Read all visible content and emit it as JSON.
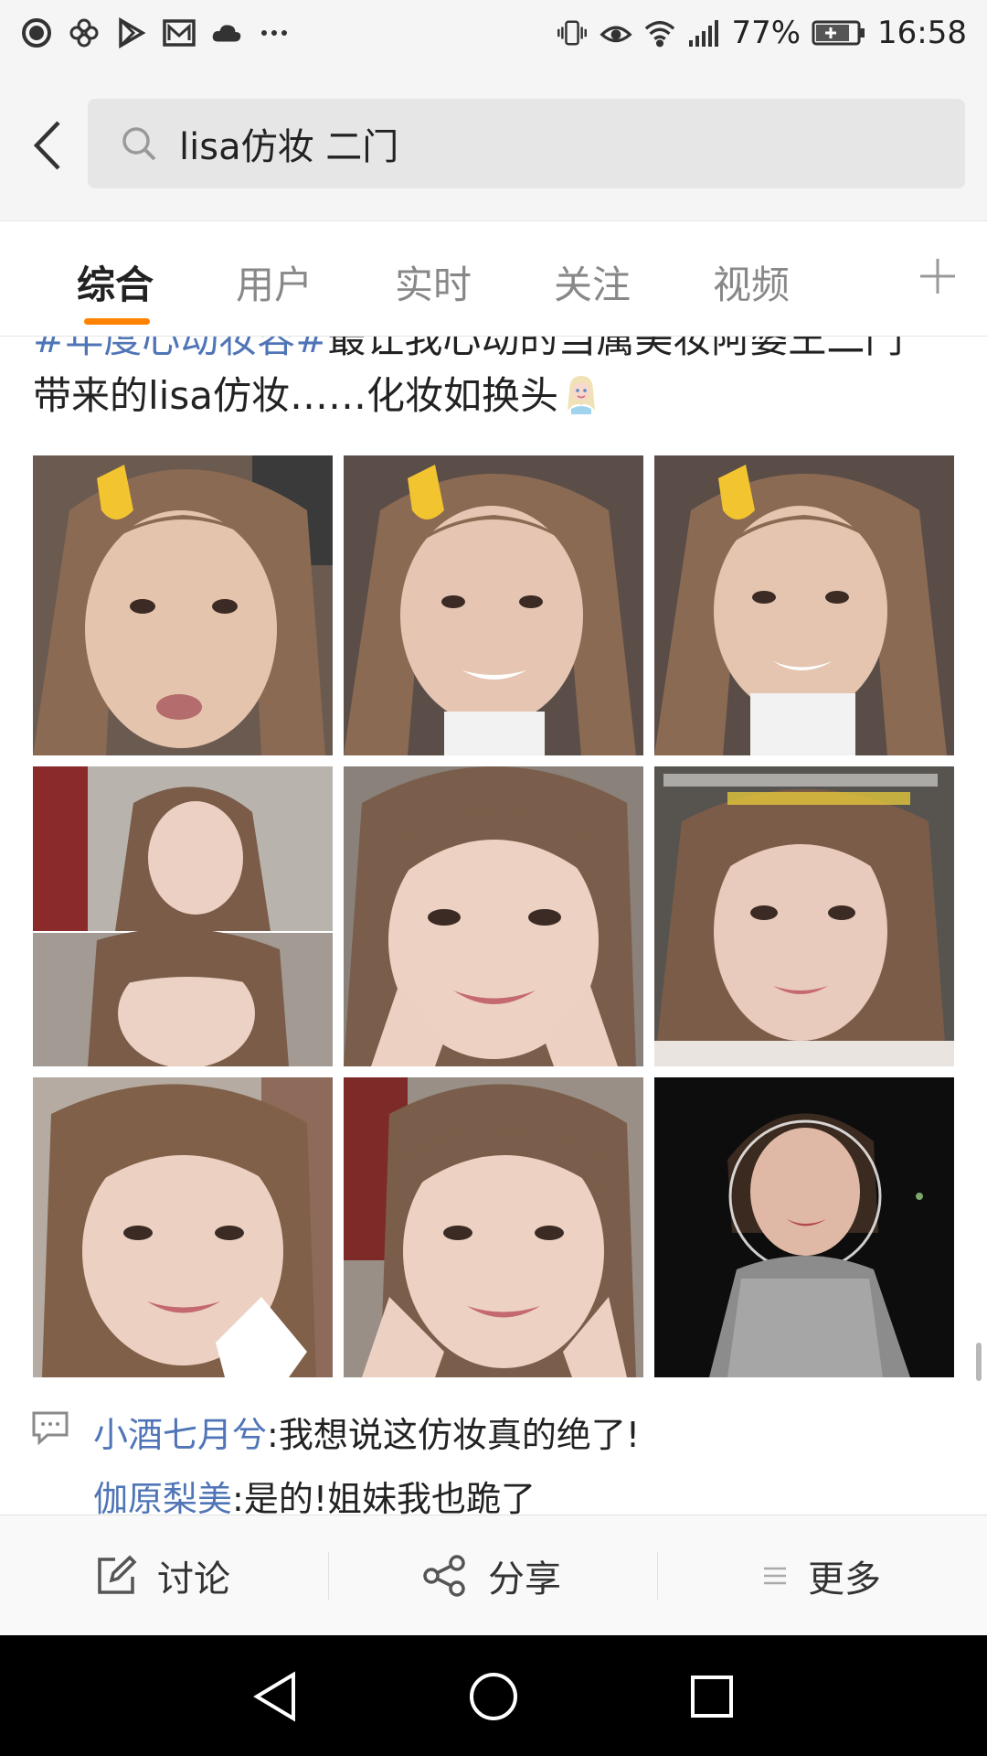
{
  "status_bar": {
    "battery": "77%",
    "time": "16:58",
    "left_icons": [
      "circle-icon",
      "clover-icon",
      "play-store-icon",
      "mail-icon",
      "cloud-icon",
      "more-dots-icon"
    ],
    "right_icons": [
      "vibrate-icon",
      "eye-icon",
      "wifi-icon",
      "signal-icon",
      "battery-icon"
    ]
  },
  "search": {
    "query": "lisa仿妆 二门"
  },
  "tabs": [
    {
      "label": "综合",
      "active": true
    },
    {
      "label": "用户",
      "active": false
    },
    {
      "label": "实时",
      "active": false
    },
    {
      "label": "关注",
      "active": false
    },
    {
      "label": "视频",
      "active": false
    }
  ],
  "post": {
    "topic": "#年度心动妆容#",
    "text_line1_rest": "最让我心动的当属美妆阿婆王二门",
    "text_line2": "带来的lisa仿妆……化妆如换头",
    "images": [
      {
        "alt": "no-makeup face with yellow hair clip",
        "kind": "before"
      },
      {
        "alt": "no-makeup face smiling with yellow hair clip",
        "kind": "before"
      },
      {
        "alt": "no-makeup face with turtleneck",
        "kind": "before"
      },
      {
        "alt": "lisa makeup collage",
        "kind": "after"
      },
      {
        "alt": "lisa makeup hands on cheeks",
        "kind": "after"
      },
      {
        "alt": "lisa makeup side glance",
        "kind": "after"
      },
      {
        "alt": "lisa makeup smiling",
        "kind": "after"
      },
      {
        "alt": "lisa makeup hands on cheeks close",
        "kind": "after"
      },
      {
        "alt": "lisa on stage",
        "kind": "stage"
      }
    ]
  },
  "comments": [
    {
      "name": "小酒七月兮",
      "text": ":我想说这仿妆真的绝了!"
    },
    {
      "name": "伽原梨美",
      "text": ":是的!姐妹我也跪了"
    }
  ],
  "actions": {
    "discuss": "讨论",
    "share": "分享",
    "more": "更多"
  },
  "colors": {
    "accent": "#ff8200",
    "link": "#5075b7"
  }
}
